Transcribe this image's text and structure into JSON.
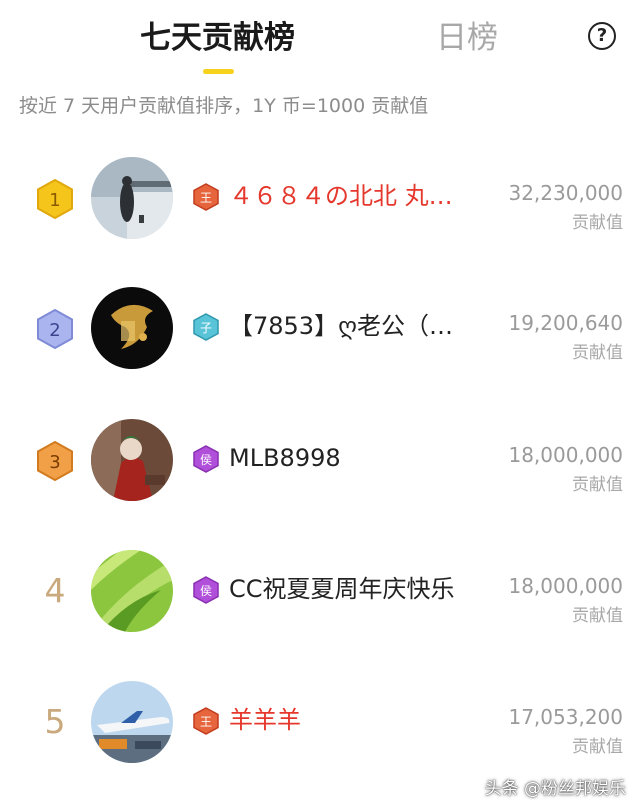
{
  "tabs": {
    "active": "七天贡献榜",
    "inactive": "日榜"
  },
  "help_label": "?",
  "subtitle": "按近 7 天用户贡献值排序，1Y 币=1000 贡献值",
  "score_unit": "贡献值",
  "rows": [
    {
      "rank": "1",
      "badge_char": "王",
      "name": "４６８４の北北 丸…",
      "name_color": "#e5372b",
      "score": "32,230,000"
    },
    {
      "rank": "2",
      "badge_char": "子",
      "name": "【7853】ღ老公（…",
      "name_color": "#222222",
      "score": "19,200,640"
    },
    {
      "rank": "3",
      "badge_char": "侯",
      "name": "MLB8998",
      "name_color": "#222222",
      "score": "18,000,000"
    },
    {
      "rank": "4",
      "badge_char": "侯",
      "name": "CC祝夏夏周年庆快乐",
      "name_color": "#222222",
      "score": "18,000,000"
    },
    {
      "rank": "5",
      "badge_char": "王",
      "name": "羊羊羊",
      "name_color": "#e5372b",
      "score": "17,053,200"
    }
  ],
  "watermark": "头条 @粉丝邦娱乐",
  "colors": {
    "accent": "#f7d21c",
    "red_name": "#e5372b",
    "rank_plain": "#c9a97d"
  }
}
